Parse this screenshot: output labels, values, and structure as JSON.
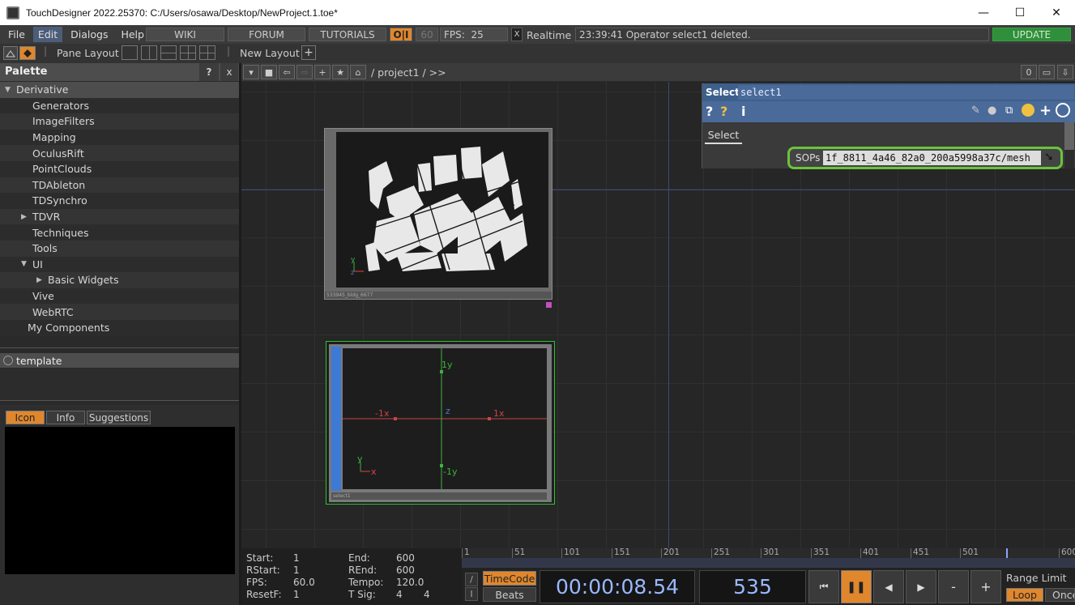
{
  "window": {
    "title": "TouchDesigner 2022.25370: C:/Users/osawa/Desktop/NewProject.1.toe*",
    "minimize": "—",
    "maximize": "☐",
    "close": "✕"
  },
  "menu": {
    "items": [
      "File",
      "Edit",
      "Dialogs",
      "Help"
    ],
    "wiki": "WIKI",
    "forum": "FORUM",
    "tutorials": "TUTORIALS",
    "oi": "O|I",
    "fps_target": "60",
    "fps_label": "FPS:",
    "fps_value": "25",
    "realtime_check": "X",
    "realtime_label": "Realtime",
    "status": "23:39:41 Operator select1 deleted.",
    "update": "UPDATE"
  },
  "toolbar": {
    "pane_layout": "Pane Layout",
    "new_layout": "New Layout",
    "plus": "+"
  },
  "palette": {
    "title": "Palette",
    "help": "?",
    "close": "x",
    "tree": [
      {
        "label": "Derivative",
        "indent": 0,
        "arrow": "down",
        "selected": true
      },
      {
        "label": "Generators",
        "indent": 2
      },
      {
        "label": "ImageFilters",
        "indent": 2
      },
      {
        "label": "Mapping",
        "indent": 2
      },
      {
        "label": "OculusRift",
        "indent": 2
      },
      {
        "label": "PointClouds",
        "indent": 2
      },
      {
        "label": "TDAbleton",
        "indent": 2
      },
      {
        "label": "TDSynchro",
        "indent": 2
      },
      {
        "label": "TDVR",
        "indent": 2,
        "arrow": "right"
      },
      {
        "label": "Techniques",
        "indent": 2
      },
      {
        "label": "Tools",
        "indent": 2
      },
      {
        "label": "UI",
        "indent": 2,
        "arrow": "down"
      },
      {
        "label": "Basic Widgets",
        "indent": 3,
        "arrow": "right"
      },
      {
        "label": "Vive",
        "indent": 2
      },
      {
        "label": "WebRTC",
        "indent": 2
      },
      {
        "label": "My Components",
        "indent": 1
      }
    ],
    "template": "template",
    "tabs": [
      "Icon",
      "Info",
      "Suggestions"
    ]
  },
  "network": {
    "path": "/ project1 / >>",
    "zero": "0"
  },
  "params": {
    "op_type": "Select",
    "op_name": "select1",
    "tab": "Select",
    "sops_label": "SOPs",
    "sops_value": "1f_8811_4a46_82a0_200a5998a37c/mesh"
  },
  "node1": {
    "label": "533945_bldg_6677"
  },
  "node2": {
    "label": "select1",
    "axis": {
      "y_pos": "1y",
      "y_neg": "-1y",
      "x_pos": "1x",
      "x_neg": "-1x",
      "z": "z",
      "corner_y": "y",
      "corner_x": "x"
    }
  },
  "timeline": {
    "start_l": "Start:",
    "start_v": "1",
    "end_l": "End:",
    "end_v": "600",
    "rstart_l": "RStart:",
    "rstart_v": "1",
    "rend_l": "REnd:",
    "rend_v": "600",
    "fps_l": "FPS:",
    "fps_v": "60.0",
    "tempo_l": "Tempo:",
    "tempo_v": "120.0",
    "resetf_l": "ResetF:",
    "resetf_v": "1",
    "tsig_l": "T Sig:",
    "tsig_a": "4",
    "tsig_b": "4",
    "ticks": [
      "1",
      "51",
      "101",
      "151",
      "201",
      "251",
      "301",
      "351",
      "401",
      "451",
      "501",
      "600"
    ],
    "timecode_btn": "TimeCode",
    "beats_btn": "Beats",
    "timecode": "00:00:08.54",
    "frame": "535",
    "range_limit": "Range Limit",
    "loop": "Loop",
    "once": "Once",
    "minus": "-",
    "plus": "+"
  },
  "colors": {
    "accent_orange": "#e0872d",
    "update_green": "#2f8f3a",
    "select_blue": "#4a6a8f",
    "node_green": "#2ec42e",
    "timecode_blue": "#9ab8ff"
  }
}
